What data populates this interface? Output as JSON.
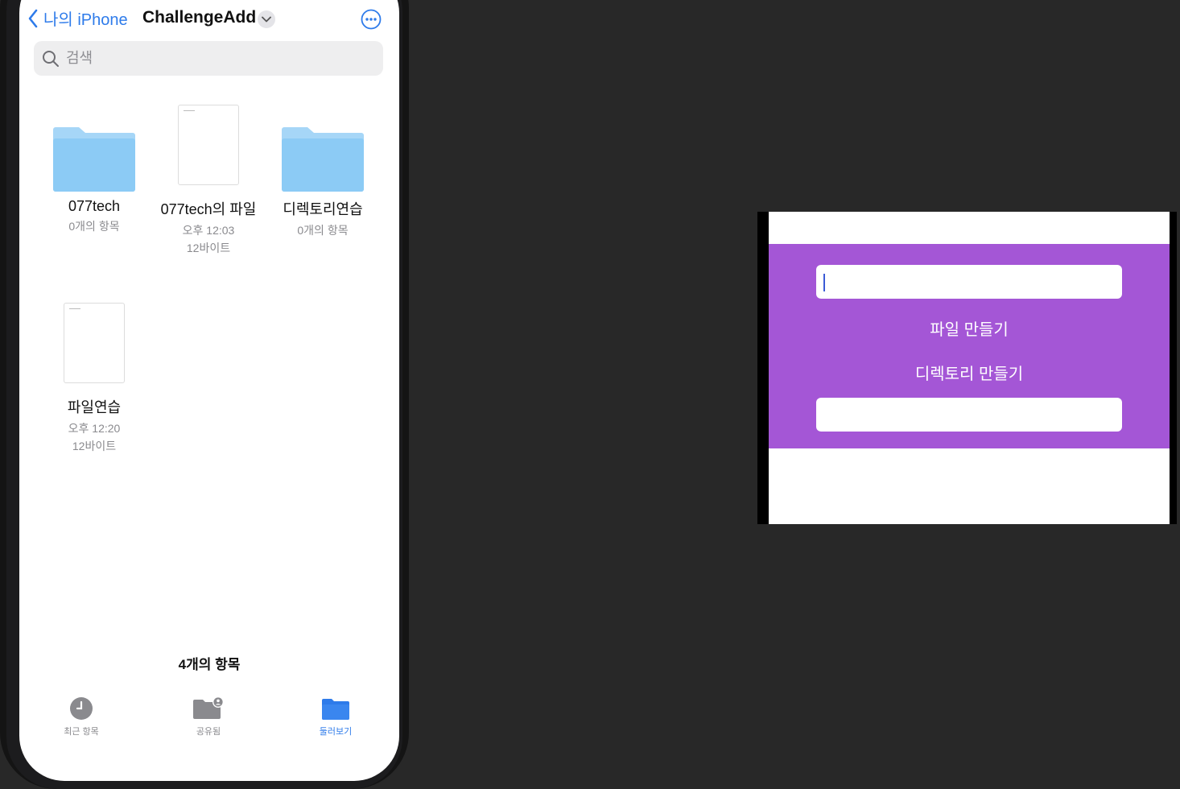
{
  "files_app": {
    "back_label": "나의 iPhone",
    "title": "ChallengeAdd",
    "search_placeholder": "검색",
    "items": [
      {
        "name": "077tech",
        "line1": "0개의 항목",
        "line2": "",
        "kind": "folder"
      },
      {
        "name": "077tech의 파일",
        "line1": "오후 12:03",
        "line2": "12바이트",
        "kind": "document"
      },
      {
        "name": "디렉토리연습",
        "line1": "0개의 항목",
        "line2": "",
        "kind": "folder"
      },
      {
        "name": "파일연습",
        "line1": "오후 12:20",
        "line2": "12바이트",
        "kind": "document"
      }
    ],
    "item_count": "4개의 항목",
    "tabs": [
      {
        "label": "최근 항목",
        "icon": "clock-icon",
        "active": false
      },
      {
        "label": "공유됨",
        "icon": "shared-folder-icon",
        "active": false
      },
      {
        "label": "둘러보기",
        "icon": "folder-icon",
        "active": true
      }
    ]
  },
  "simulator_app": {
    "name_field_value": "",
    "create_file_label": "파일 만들기",
    "create_directory_label": "디렉토리 만들기",
    "output_field_value": ""
  },
  "colors": {
    "accent_blue": "#2e7bea",
    "folder_blue": "#8ccbf5",
    "app_purple": "#a456d6",
    "desktop_bg": "#282828"
  }
}
